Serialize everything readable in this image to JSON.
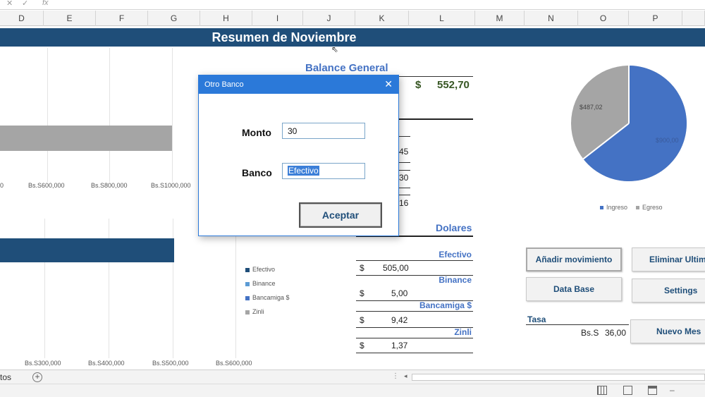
{
  "formula_bar": {
    "cancel_icon": "close-icon",
    "confirm_icon": "check-icon",
    "fx_label": "fx"
  },
  "columns": [
    "D",
    "E",
    "F",
    "G",
    "H",
    "I",
    "J",
    "K",
    "L",
    "M",
    "N",
    "O",
    "P"
  ],
  "title": "Resumen de Noviembre",
  "bar_chart_top": {
    "axis_labels": [
      "0",
      "Bs.S600,000",
      "Bs.S800,000",
      "Bs.S1000,000"
    ]
  },
  "bar_chart_bottom": {
    "axis_labels": [
      "Bs.S300,000",
      "Bs.S400,000",
      "Bs.S500,000",
      "Bs.S600,000"
    ],
    "legend": [
      "Efectivo",
      "Binance",
      "Bancamiga $",
      "Zinli"
    ]
  },
  "balance": {
    "heading": "Balance General",
    "currency": "$",
    "total": "552,70",
    "partial_values": [
      "45",
      "30",
      "16"
    ]
  },
  "dolares": {
    "heading": "Dolares",
    "rows": [
      {
        "label": "Efectivo",
        "currency": "$",
        "value": "505,00"
      },
      {
        "label": "Binance",
        "currency": "$",
        "value": "5,00"
      },
      {
        "label": "Bancamiga $",
        "currency": "$",
        "value": "9,42"
      },
      {
        "label": "Zinli",
        "currency": "$",
        "value": "1,37"
      }
    ]
  },
  "pie_chart": {
    "labels": [
      "$487,02",
      "$900,00"
    ],
    "legend": [
      "Ingreso",
      "Egreso"
    ],
    "colors": {
      "ingreso": "#4472c4",
      "egreso": "#a5a5a5"
    }
  },
  "buttons": {
    "add_movement": "Añadir movimiento",
    "delete_last": "Eliminar Ultim",
    "database": "Data Base",
    "settings": "Settings",
    "new_month": "Nuevo Mes"
  },
  "tasa": {
    "label": "Tasa",
    "currency": "Bs.S",
    "value": "36,00"
  },
  "dialog": {
    "title": "Otro Banco",
    "monto_label": "Monto",
    "monto_value": "30",
    "banco_label": "Banco",
    "banco_value": "Efectivo",
    "accept_button": "Aceptar"
  },
  "sheet_tabs": {
    "current_tab_fragment": "tos",
    "add_sheet": "+"
  },
  "colors": {
    "title_band": "#1f4e79",
    "dialog_accent": "#2b79d9",
    "bar_gray": "#a5a5a5",
    "bar_navy": "#1f4e79"
  }
}
